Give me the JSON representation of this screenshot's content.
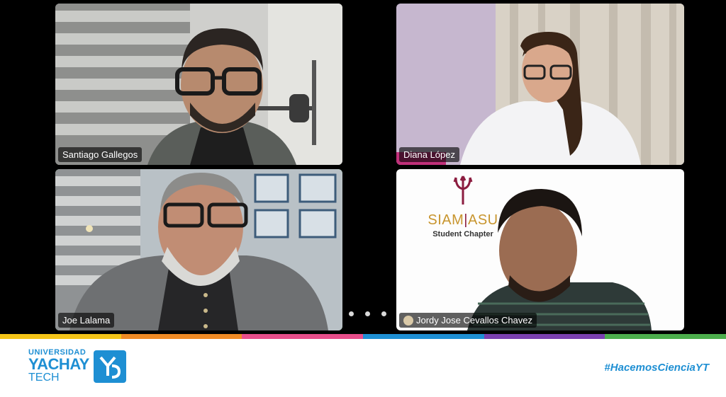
{
  "participants": [
    {
      "name": "Santiago Gallegos"
    },
    {
      "name": "Diana López"
    },
    {
      "name": "Joe Lalama"
    },
    {
      "name": "Jordy Jose Cevallos Chavez"
    }
  ],
  "siam_logo": {
    "title_left": "SIAM",
    "title_sep": "|",
    "title_right": "ASU",
    "subtitle": "Student Chapter"
  },
  "footer": {
    "logo": {
      "line1": "UNIVERSIDAD",
      "line2": "YACHAY",
      "line3": "TECH"
    },
    "hashtag": "#HacemosCienciaYT"
  },
  "colors": {
    "accent": "#1e8fd3",
    "active_speaker": "#5bd16a",
    "band": [
      "#f5c518",
      "#f08a24",
      "#e84d8a",
      "#1e8fd3",
      "#7a3fb0",
      "#4cae4c"
    ]
  }
}
